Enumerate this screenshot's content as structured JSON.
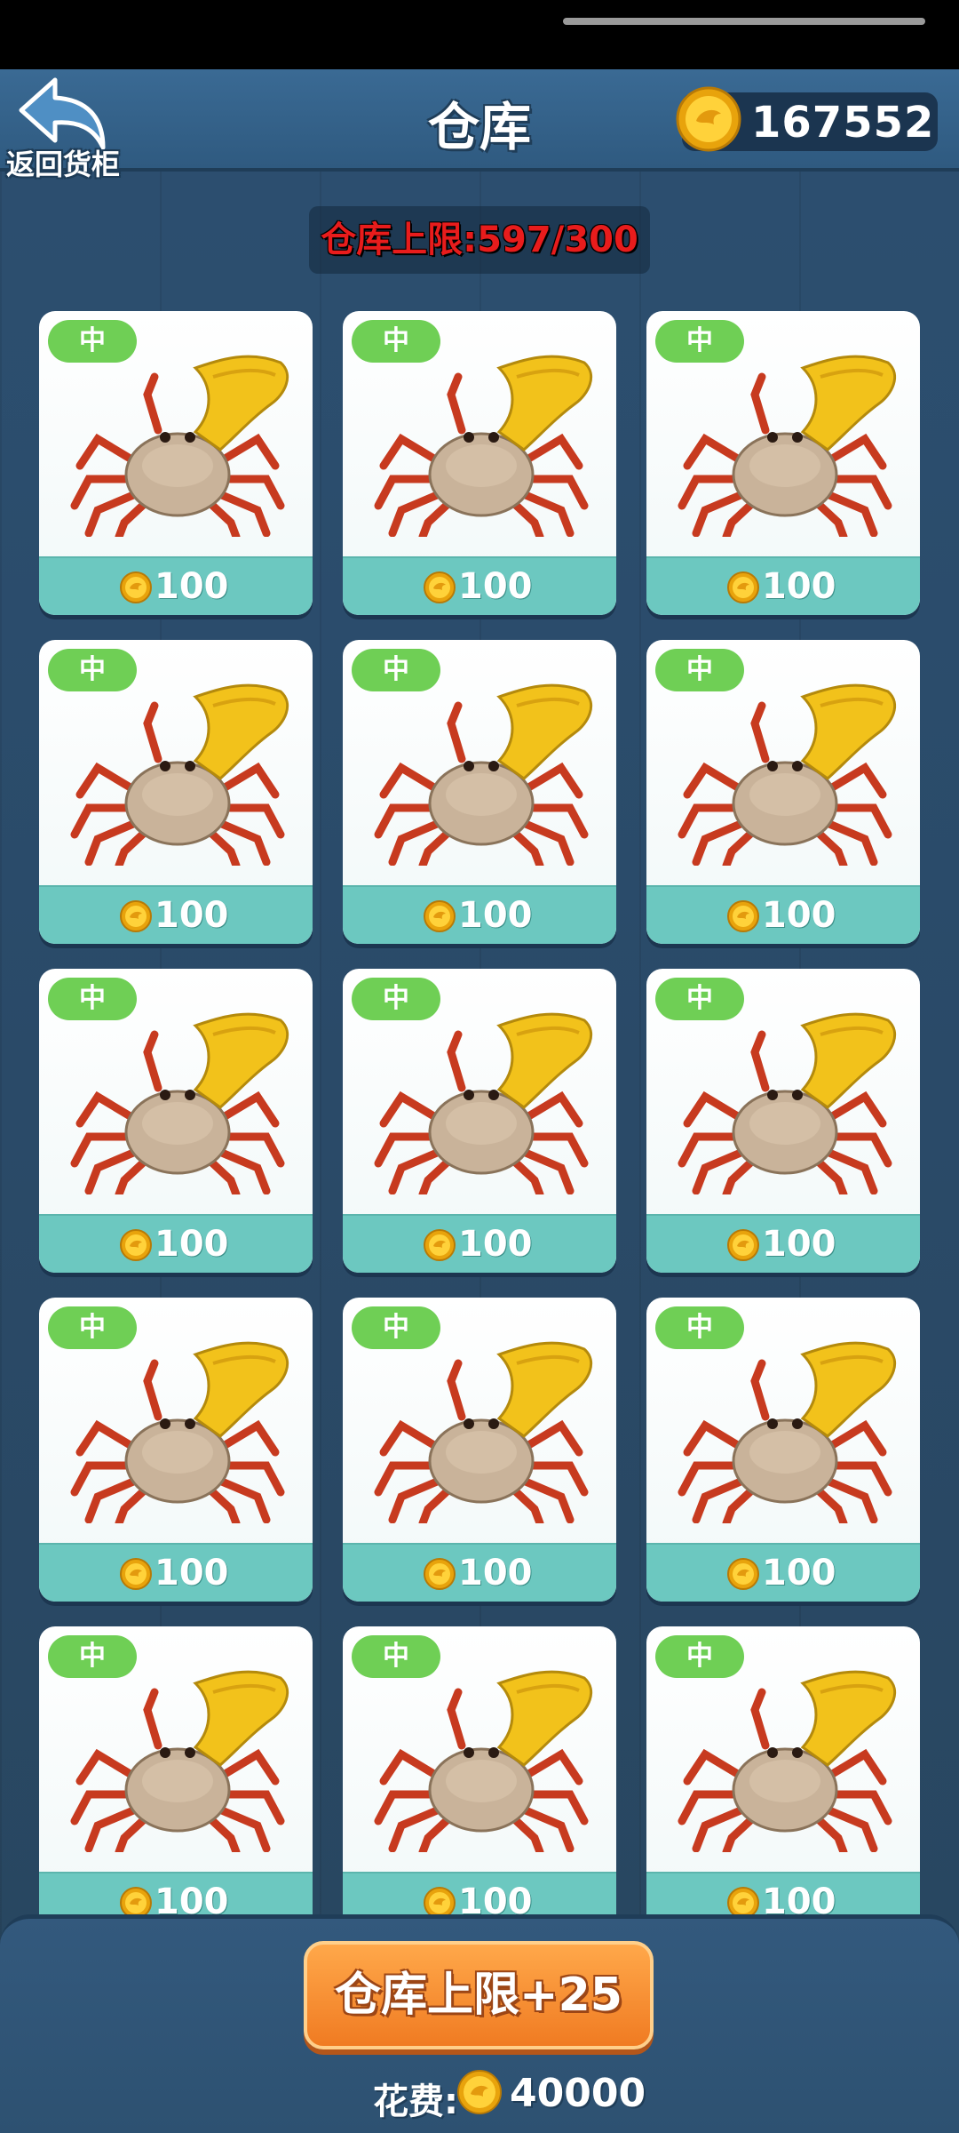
{
  "header": {
    "back_label": "返回货柜",
    "title": "仓库",
    "coins": "167552"
  },
  "capacity": {
    "label": "仓库上限:597/300"
  },
  "items": [
    {
      "badge": "中",
      "price": "100"
    },
    {
      "badge": "中",
      "price": "100"
    },
    {
      "badge": "中",
      "price": "100"
    },
    {
      "badge": "中",
      "price": "100"
    },
    {
      "badge": "中",
      "price": "100"
    },
    {
      "badge": "中",
      "price": "100"
    },
    {
      "badge": "中",
      "price": "100"
    },
    {
      "badge": "中",
      "price": "100"
    },
    {
      "badge": "中",
      "price": "100"
    },
    {
      "badge": "中",
      "price": "100"
    },
    {
      "badge": "中",
      "price": "100"
    },
    {
      "badge": "中",
      "price": "100"
    },
    {
      "badge": "中",
      "price": "100"
    },
    {
      "badge": "中",
      "price": "100"
    },
    {
      "badge": "中",
      "price": "100"
    }
  ],
  "footer": {
    "upgrade_label": "仓库上限+25",
    "cost_label": "花费:",
    "cost_amount": "40000"
  },
  "colors": {
    "background": "#2a4a68",
    "badge": "#6fcf55",
    "price_bar": "#6cc8c0",
    "capacity_text": "#e81c1c",
    "button": "#f07b22"
  },
  "icons": {
    "back": "back-arrow-icon",
    "coin": "coin-icon",
    "item": "crab-icon"
  }
}
